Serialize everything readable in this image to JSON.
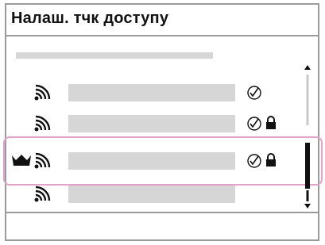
{
  "title": "Налаш. тчк доступу",
  "network_list": [
    {
      "has_check": true,
      "has_lock": false,
      "selected": false,
      "has_crown": false
    },
    {
      "has_check": true,
      "has_lock": true,
      "selected": false,
      "has_crown": false
    },
    {
      "has_check": true,
      "has_lock": true,
      "selected": true,
      "has_crown": true
    },
    {
      "has_check": false,
      "has_lock": false,
      "selected": false,
      "has_crown": false
    }
  ],
  "icons": {
    "wifi": "wifi-signal-icon",
    "check": "check-circle-icon",
    "lock": "lock-icon",
    "crown": "crown-icon",
    "scroll_up": "scroll-up-arrow-icon",
    "scroll_down": "scroll-down-arrow-icon"
  },
  "colors": {
    "frame": "#9a9a9a",
    "placeholder_bar": "#d6d6d6",
    "selection_outline": "#e3a3c7",
    "text": "#111111"
  }
}
